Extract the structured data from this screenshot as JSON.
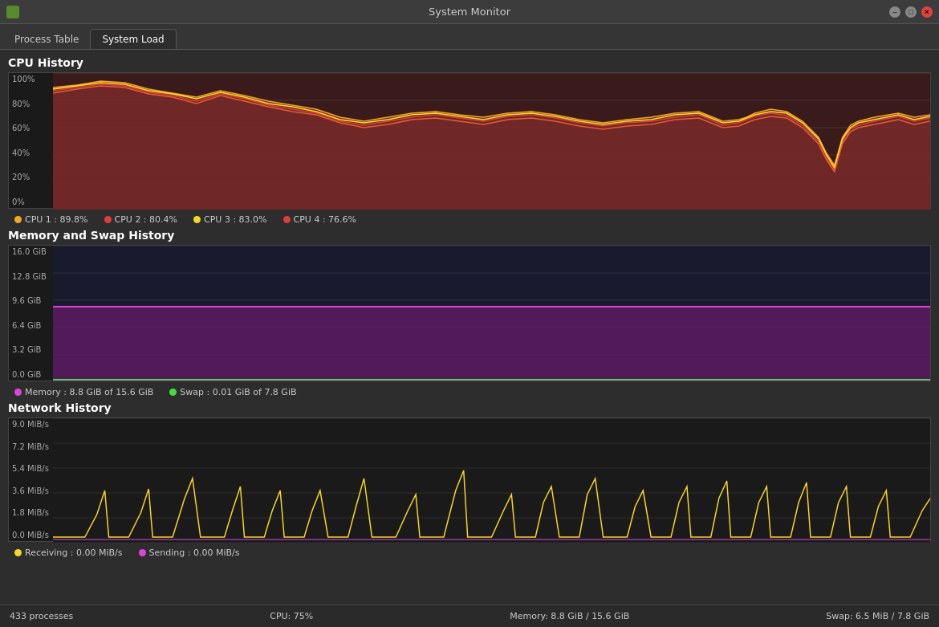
{
  "window": {
    "title": "System Monitor",
    "icon": "monitor-icon"
  },
  "tabs": [
    {
      "label": "Process Table",
      "active": false
    },
    {
      "label": "System Load",
      "active": true
    }
  ],
  "cpu_section": {
    "title": "CPU History",
    "y_labels": [
      "100%",
      "80%",
      "60%",
      "40%",
      "20%",
      "0%"
    ],
    "legend": [
      {
        "label": "CPU 1 : 89.8%",
        "color": "#f5a623"
      },
      {
        "label": "CPU 2 : 80.4%",
        "color": "#e03c3c"
      },
      {
        "label": "CPU 3 : 83.0%",
        "color": "#f5d623"
      },
      {
        "label": "CPU 4 : 76.6%",
        "color": "#e03c3c"
      }
    ]
  },
  "memory_section": {
    "title": "Memory and Swap History",
    "y_labels": [
      "16.0 GiB",
      "12.8 GiB",
      "9.6 GiB",
      "6.4 GiB",
      "3.2 GiB",
      "0.0 GiB"
    ],
    "legend": [
      {
        "label": "Memory : 8.8 GiB of 15.6 GiB",
        "color": "#dd44dd"
      },
      {
        "label": "Swap : 0.01 GiB of 7.8 GiB",
        "color": "#44dd44"
      }
    ]
  },
  "network_section": {
    "title": "Network History",
    "y_labels": [
      "9.0 MiB/s",
      "7.2 MiB/s",
      "5.4 MiB/s",
      "3.6 MiB/s",
      "1.8 MiB/s",
      "0.0 MiB/s"
    ],
    "legend": [
      {
        "label": "Receiving : 0.00 MiB/s",
        "color": "#f5d623"
      },
      {
        "label": "Sending : 0.00 MiB/s",
        "color": "#dd44dd"
      }
    ]
  },
  "status_bar": {
    "processes": "433 processes",
    "cpu": "CPU: 75%",
    "memory": "Memory: 8.8 GiB / 15.6 GiB",
    "swap": "Swap: 6.5 MiB / 7.8 GiB"
  },
  "controls": {
    "minimize": "–",
    "maximize": "□",
    "close": "✕"
  }
}
